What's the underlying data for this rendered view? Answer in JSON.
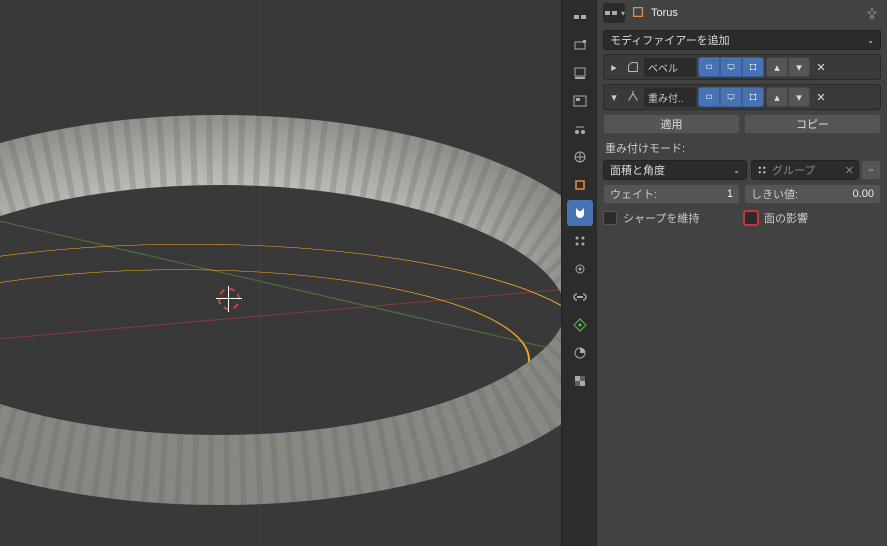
{
  "header": {
    "object_name": "Torus"
  },
  "modifier_add": {
    "label": "モディファイアーを追加"
  },
  "modifiers": [
    {
      "name": "ベベル",
      "expanded": false
    },
    {
      "name": "重み付..",
      "expanded": true
    }
  ],
  "apply_row": {
    "apply": "適用",
    "copy": "コピー"
  },
  "weighted_normal": {
    "mode_label": "重み付けモード:",
    "mode_value": "面積と角度",
    "vgroup_label": "グループ",
    "weight_label": "ウェイト:",
    "weight_value": "1",
    "threshold_label": "しきい値:",
    "threshold_value": "0.00",
    "keep_sharp_label": "シャープを維持",
    "face_influence_label": "面の影響"
  },
  "icons": {
    "pin": "pin-icon",
    "object": "object-icon"
  }
}
